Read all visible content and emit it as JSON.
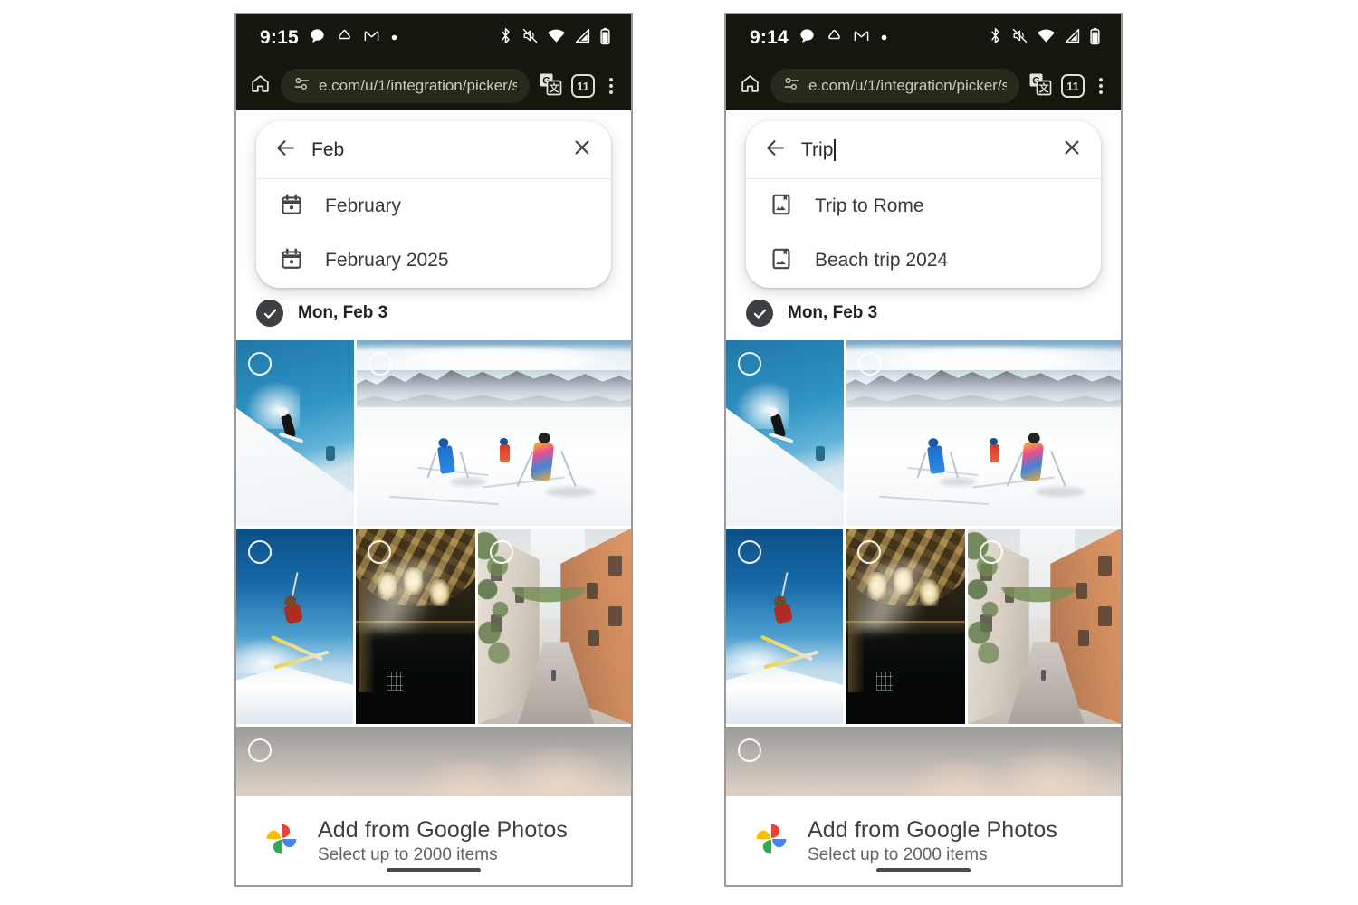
{
  "panels": [
    {
      "id": "left",
      "status": {
        "time": "9:15",
        "left_icons": [
          "chat-bubble-icon",
          "google-home-icon",
          "gmail-icon",
          "dot-icon"
        ],
        "right_icons": [
          "bluetooth-icon",
          "volume-muted-icon",
          "wifi-icon",
          "cell-signal-icon",
          "battery-icon"
        ]
      },
      "browser": {
        "home_icon": "home-icon",
        "site_info_icon": "site-settings-icon",
        "url": "e.com/u/1/integration/picker/s",
        "translate_icon": "google-translate-icon",
        "tab_count": "11",
        "menu_icon": "overflow-menu-icon"
      },
      "search": {
        "back_icon": "back-arrow-icon",
        "query": "Feb",
        "show_caret": false,
        "clear_icon": "close-icon",
        "suggestions": [
          {
            "icon": "calendar-icon",
            "label": "February"
          },
          {
            "icon": "calendar-icon",
            "label": "February 2025"
          }
        ]
      },
      "date_header": {
        "checked": true,
        "label": "Mon, Feb 3"
      },
      "bottom": {
        "logo": "google-photos-logo",
        "title": "Add from Google Photos",
        "subtitle": "Select up to 2000 items"
      }
    },
    {
      "id": "right",
      "status": {
        "time": "9:14",
        "left_icons": [
          "chat-bubble-icon",
          "google-home-icon",
          "gmail-icon",
          "dot-icon"
        ],
        "right_icons": [
          "bluetooth-icon",
          "volume-muted-icon",
          "wifi-icon",
          "cell-signal-icon",
          "battery-icon"
        ]
      },
      "browser": {
        "home_icon": "home-icon",
        "site_info_icon": "site-settings-icon",
        "url": "e.com/u/1/integration/picker/s",
        "translate_icon": "google-translate-icon",
        "tab_count": "11",
        "menu_icon": "overflow-menu-icon"
      },
      "search": {
        "back_icon": "back-arrow-icon",
        "query": "Trip",
        "show_caret": true,
        "clear_icon": "close-icon",
        "suggestions": [
          {
            "icon": "album-icon",
            "label": "Trip to Rome"
          },
          {
            "icon": "album-icon",
            "label": "Beach trip 2024"
          }
        ]
      },
      "date_header": {
        "checked": true,
        "label": "Mon, Feb 3"
      },
      "bottom": {
        "logo": "google-photos-logo",
        "title": "Add from Google Photos",
        "subtitle": "Select up to 2000 items"
      }
    }
  ],
  "photos": [
    {
      "id": "p1",
      "alt": "Skier descending steep slope against blue sky",
      "selected": false
    },
    {
      "id": "p2",
      "alt": "Group of skiers on wide snowfield with mountain ridge",
      "selected": false
    },
    {
      "id": "p3",
      "alt": "Skier mid-air jump over snow",
      "selected": false
    },
    {
      "id": "p4",
      "alt": "Dark basilica interior with coffered vault and light ray",
      "selected": false
    },
    {
      "id": "p5",
      "alt": "Narrow Italian street with ivy-covered buildings",
      "selected": false
    },
    {
      "id": "p6",
      "alt": "Pale sky with clouds and distant dome",
      "selected": false
    }
  ],
  "colors": {
    "status_bar_bg": "#15170f",
    "omnibox_bg": "#262a1d",
    "check_circle": "#3c4043",
    "photos_red": "#EA4335",
    "photos_blue": "#4285F4",
    "photos_green": "#34A853",
    "photos_yellow": "#FBBC04"
  }
}
